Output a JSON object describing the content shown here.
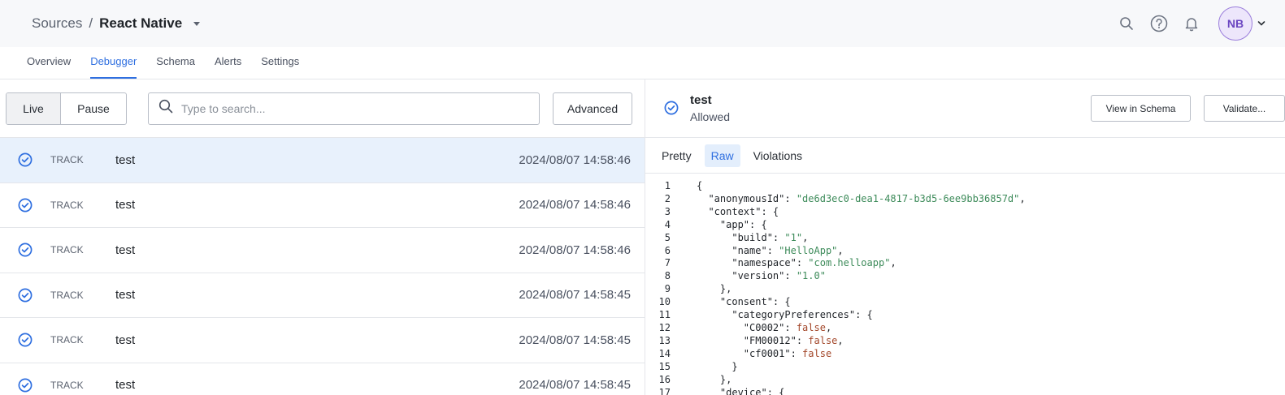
{
  "header": {
    "breadcrumb_parent": "Sources",
    "breadcrumb_sep": "/",
    "breadcrumb_current": "React Native",
    "avatar_initials": "NB"
  },
  "tabs": [
    "Overview",
    "Debugger",
    "Schema",
    "Alerts",
    "Settings"
  ],
  "active_tab": "Debugger",
  "toolbar": {
    "live_label": "Live",
    "pause_label": "Pause",
    "search_placeholder": "Type to search...",
    "advanced_label": "Advanced"
  },
  "events": [
    {
      "type": "TRACK",
      "name": "test",
      "timestamp": "2024/08/07 14:58:46",
      "selected": true
    },
    {
      "type": "TRACK",
      "name": "test",
      "timestamp": "2024/08/07 14:58:46",
      "selected": false
    },
    {
      "type": "TRACK",
      "name": "test",
      "timestamp": "2024/08/07 14:58:46",
      "selected": false
    },
    {
      "type": "TRACK",
      "name": "test",
      "timestamp": "2024/08/07 14:58:45",
      "selected": false
    },
    {
      "type": "TRACK",
      "name": "test",
      "timestamp": "2024/08/07 14:58:45",
      "selected": false
    },
    {
      "type": "TRACK",
      "name": "test",
      "timestamp": "2024/08/07 14:58:45",
      "selected": false
    }
  ],
  "detail": {
    "title": "test",
    "status": "Allowed",
    "view_in_schema_label": "View in Schema",
    "validate_label": "Validate...",
    "tabs": [
      "Pretty",
      "Raw",
      "Violations"
    ],
    "active_tab": "Raw"
  },
  "colors": {
    "accent": "#2f6fe0",
    "selected_row": "#e8f1fc",
    "string": "#3d8b5a",
    "boolean": "#a3472a"
  },
  "code_lines": [
    {
      "n": "1",
      "parts": [
        [
          "p",
          "{"
        ]
      ]
    },
    {
      "n": "2",
      "parts": [
        [
          "p",
          "  \"anonymousId\": "
        ],
        [
          "s",
          "\"de6d3ec0-dea1-4817-b3d5-6ee9bb36857d\""
        ],
        [
          "p",
          ","
        ]
      ]
    },
    {
      "n": "3",
      "parts": [
        [
          "p",
          "  \"context\": {"
        ]
      ]
    },
    {
      "n": "4",
      "parts": [
        [
          "p",
          "    \"app\": {"
        ]
      ]
    },
    {
      "n": "5",
      "parts": [
        [
          "p",
          "      \"build\": "
        ],
        [
          "s",
          "\"1\""
        ],
        [
          "p",
          ","
        ]
      ]
    },
    {
      "n": "6",
      "parts": [
        [
          "p",
          "      \"name\": "
        ],
        [
          "s",
          "\"HelloApp\""
        ],
        [
          "p",
          ","
        ]
      ]
    },
    {
      "n": "7",
      "parts": [
        [
          "p",
          "      \"namespace\": "
        ],
        [
          "s",
          "\"com.helloapp\""
        ],
        [
          "p",
          ","
        ]
      ]
    },
    {
      "n": "8",
      "parts": [
        [
          "p",
          "      \"version\": "
        ],
        [
          "s",
          "\"1.0\""
        ]
      ]
    },
    {
      "n": "9",
      "parts": [
        [
          "p",
          "    },"
        ]
      ]
    },
    {
      "n": "10",
      "parts": [
        [
          "p",
          "    \"consent\": {"
        ]
      ]
    },
    {
      "n": "11",
      "parts": [
        [
          "p",
          "      \"categoryPreferences\": {"
        ]
      ]
    },
    {
      "n": "12",
      "parts": [
        [
          "p",
          "        \"C0002\": "
        ],
        [
          "b",
          "false"
        ],
        [
          "p",
          ","
        ]
      ]
    },
    {
      "n": "13",
      "parts": [
        [
          "p",
          "        \"FM00012\": "
        ],
        [
          "b",
          "false"
        ],
        [
          "p",
          ","
        ]
      ]
    },
    {
      "n": "14",
      "parts": [
        [
          "p",
          "        \"cf0001\": "
        ],
        [
          "b",
          "false"
        ]
      ]
    },
    {
      "n": "15",
      "parts": [
        [
          "p",
          "      }"
        ]
      ]
    },
    {
      "n": "16",
      "parts": [
        [
          "p",
          "    },"
        ]
      ]
    },
    {
      "n": "17",
      "parts": [
        [
          "p",
          "    \"device\": {"
        ]
      ]
    }
  ]
}
